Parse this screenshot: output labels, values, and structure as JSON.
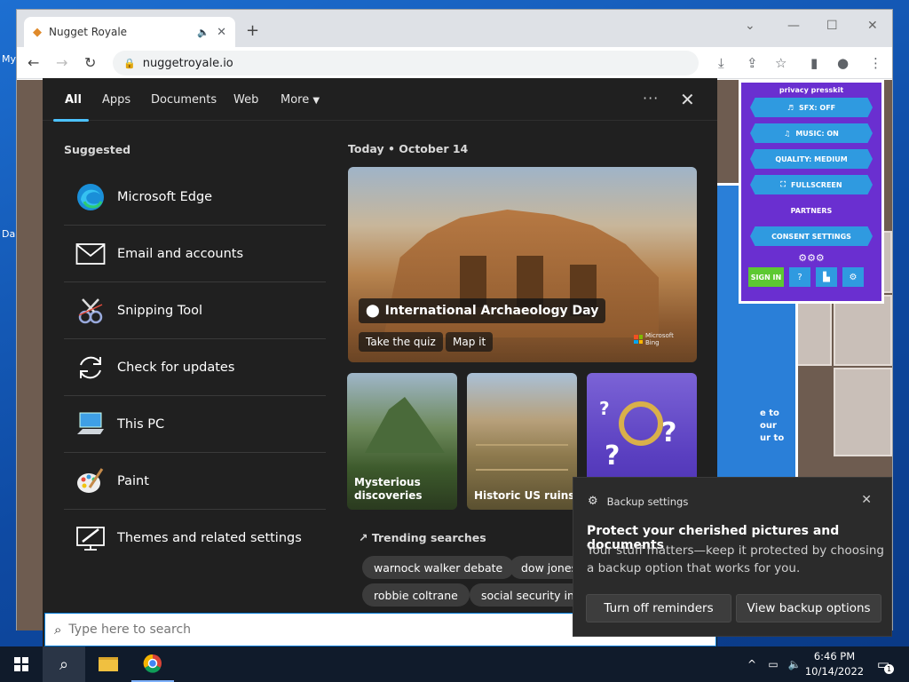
{
  "desktop": {
    "label_1": "My",
    "label_2": "Da"
  },
  "browser": {
    "tab_title": "Nugget Royale",
    "url": "nuggetroyale.io"
  },
  "game_settings": {
    "caption": "privacy presskit",
    "buttons": [
      "SFX: OFF",
      "MUSIC: ON",
      "QUALITY: MEDIUM",
      "FULLSCREEN"
    ],
    "partners": "PARTNERS",
    "consent": "CONSENT SETTINGS",
    "sign_in": "SIGN IN",
    "side_text": [
      "e to",
      "our",
      "ur to"
    ]
  },
  "search": {
    "tabs": [
      "All",
      "Apps",
      "Documents",
      "Web",
      "More"
    ],
    "suggested_title": "Suggested",
    "suggested": [
      {
        "label": "Microsoft Edge",
        "icon": "edge-icon"
      },
      {
        "label": "Email and accounts",
        "icon": "mail-icon"
      },
      {
        "label": "Snipping Tool",
        "icon": "snipping-tool-icon"
      },
      {
        "label": "Check for updates",
        "icon": "sync-icon"
      },
      {
        "label": "This PC",
        "icon": "computer-icon"
      },
      {
        "label": "Paint",
        "icon": "paint-icon"
      },
      {
        "label": "Themes and related settings",
        "icon": "themes-icon"
      }
    ],
    "today": "Today  •  October 14",
    "hero_title": "International Archaeology Day",
    "hero_quiz": "Take the quiz",
    "hero_map": "Map it",
    "bing": "Microsoft Bing",
    "cards": [
      "Mysterious discoveries",
      "Historic US ruins",
      ""
    ],
    "trending_title": "Trending searches",
    "chips": [
      "warnock walker debate",
      "dow jones",
      "robbie coltrane",
      "social security inc"
    ],
    "placeholder": "Type here to search"
  },
  "toast": {
    "header": "Backup settings",
    "title": "Protect your cherished pictures and documents",
    "body": "Your stuff matters—keep it protected by choosing a backup option that works for you.",
    "btn_off": "Turn off reminders",
    "btn_view": "View backup options"
  },
  "taskbar": {
    "time": "6:46 PM",
    "date": "10/14/2022",
    "notifications": "1"
  },
  "colors": {
    "accent": "#4cc2ff",
    "flyout_bg": "#202020",
    "taskbar_bg": "#101b2b"
  }
}
